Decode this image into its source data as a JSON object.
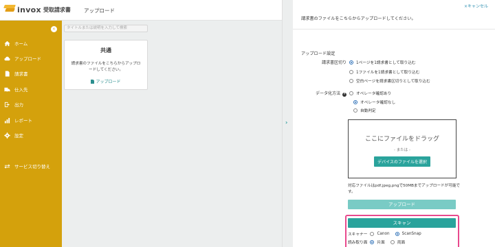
{
  "header": {
    "logo_text": "invox",
    "product_name": "受取請求書",
    "page_title": "アップロード"
  },
  "sidebar": {
    "collapse_icon": "chevron-left-icon",
    "items": [
      {
        "label": "ホーム",
        "icon": "home-icon"
      },
      {
        "label": "アップロード",
        "icon": "cloud-upload-icon"
      },
      {
        "label": "請求書",
        "icon": "document-icon"
      },
      {
        "label": "仕入先",
        "icon": "truck-icon"
      },
      {
        "label": "出力",
        "icon": "export-icon"
      },
      {
        "label": "レポート",
        "icon": "bar-chart-icon"
      },
      {
        "label": "設定",
        "icon": "gear-icon"
      },
      {
        "label": "サービス切り替え",
        "icon": "switch-icon"
      }
    ]
  },
  "main": {
    "search_placeholder": "タイトルまたは説明を入力して検索",
    "card": {
      "title": "共通",
      "description": "請求書のファイルをこちらからアップロードしてください。",
      "link": "アップロード"
    }
  },
  "panel": {
    "cancel": "×キャンセル",
    "intro": "請求書のファイルをこちらからアップロードしてください。",
    "section_title": "アップロード設定",
    "split_label": "請求書区切り",
    "split_options": [
      {
        "label": "1ページを1請求書として取り込む",
        "selected": true
      },
      {
        "label": "1ファイルを1請求書として取り込む",
        "selected": false
      },
      {
        "label": "空白ページを請求書区切りとして取り込む",
        "selected": false
      }
    ],
    "data_label": "データ化方法",
    "data_options": [
      {
        "label": "オペレータ確認あり",
        "selected": false
      },
      {
        "label": "オペレータ確認なし",
        "selected": true
      },
      {
        "label": "自動判定",
        "selected": false
      }
    ],
    "dropzone": {
      "title": "ここにファイルをドラッグ",
      "or": "- または -",
      "button": "デバイスのファイルを選択"
    },
    "note": "対応ファイルはpdf,jpeg,pngで50MBまでアップロードが可能です。",
    "upload_button": "アップロード",
    "scan_button": "スキャン",
    "scanner_label": "スキャナー",
    "scanner_options": [
      {
        "label": "Canon",
        "selected": false
      },
      {
        "label": "ScanSnap",
        "selected": true
      }
    ],
    "read_label": "読み取り面",
    "read_options": [
      {
        "label": "片面",
        "selected": true
      },
      {
        "label": "両面",
        "selected": false
      }
    ]
  },
  "colors": {
    "sidebar": "#d4a10c",
    "accent": "#2aa39c",
    "highlight": "#e8498d"
  }
}
